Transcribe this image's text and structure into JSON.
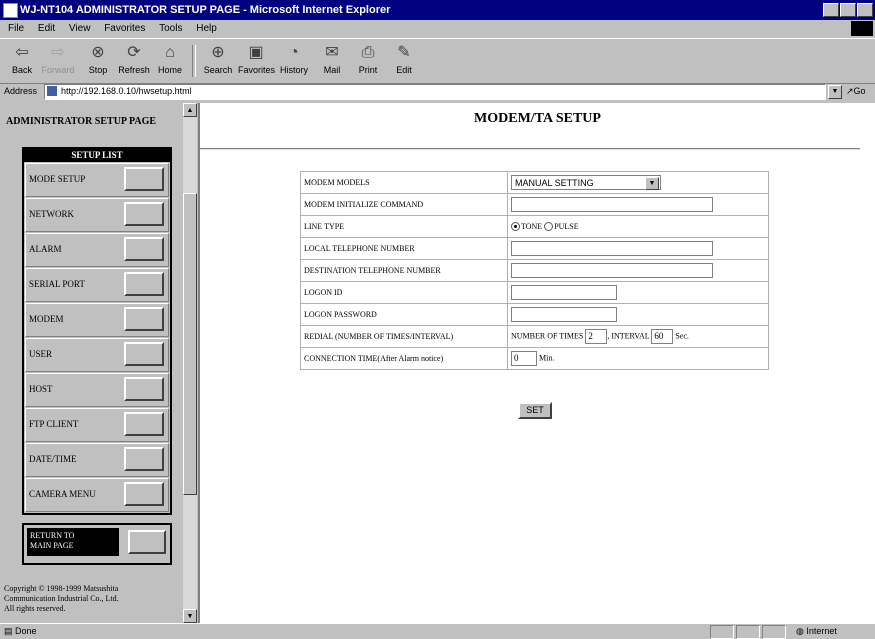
{
  "window": {
    "title": "WJ-NT104 ADMINISTRATOR SETUP PAGE - Microsoft Internet Explorer"
  },
  "menu": [
    "File",
    "Edit",
    "View",
    "Favorites",
    "Tools",
    "Help"
  ],
  "toolbar": [
    {
      "label": "Back",
      "icon": "back-arrow-icon"
    },
    {
      "label": "Forward",
      "icon": "forward-arrow-icon"
    },
    {
      "label": "Stop",
      "icon": "stop-icon"
    },
    {
      "label": "Refresh",
      "icon": "refresh-icon"
    },
    {
      "label": "Home",
      "icon": "home-icon"
    },
    {
      "label": "Search",
      "icon": "search-icon"
    },
    {
      "label": "Favorites",
      "icon": "favorites-icon"
    },
    {
      "label": "History",
      "icon": "history-icon"
    },
    {
      "label": "Mail",
      "icon": "mail-icon"
    },
    {
      "label": "Print",
      "icon": "print-icon"
    },
    {
      "label": "Edit",
      "icon": "edit-icon"
    }
  ],
  "address": {
    "label": "Address",
    "url": "http://192.168.0.10/hwsetup.html",
    "go": "Go"
  },
  "sidebar": {
    "title": "ADMINISTRATOR SETUP PAGE",
    "list_title": "SETUP LIST",
    "items": [
      "MODE SETUP",
      "NETWORK",
      "ALARM",
      "SERIAL PORT",
      "MODEM",
      "USER",
      "HOST",
      "FTP CLIENT",
      "DATE/TIME",
      "CAMERA MENU"
    ],
    "return_line1": "RETURN TO",
    "return_line2": "MAIN PAGE",
    "copyright1": "Copyright © 1998-1999 Matsushita",
    "copyright2": "Communication Industrial Co., Ltd.",
    "copyright3": "All rights reserved."
  },
  "main": {
    "title": "MODEM/TA SETUP",
    "rows": {
      "modem_models": {
        "label": "MODEM MODELS",
        "value": "MANUAL SETTING"
      },
      "init_command": {
        "label": "MODEM INITIALIZE COMMAND",
        "value": ""
      },
      "line_type": {
        "label": "LINE TYPE",
        "opt1": "TONE",
        "opt2": "PULSE",
        "selected": "TONE"
      },
      "local_tel": {
        "label": "LOCAL TELEPHONE NUMBER",
        "value": ""
      },
      "dest_tel": {
        "label": "DESTINATION TELEPHONE NUMBER",
        "value": ""
      },
      "logon_id": {
        "label": "LOGON ID",
        "value": ""
      },
      "logon_pw": {
        "label": "LOGON PASSWORD",
        "value": ""
      },
      "redial": {
        "label": "REDIAL (NUMBER OF TIMES/INTERVAL)",
        "times_label": "NUMBER OF TIMES",
        "times": "2",
        "sep": ",",
        "interval_label": "INTERVAL",
        "interval": "60",
        "unit": "Sec."
      },
      "connection": {
        "label": "CONNECTION TIME(After Alarm notice)",
        "value": "0",
        "unit": "Min."
      }
    },
    "set_label": "SET"
  },
  "status": {
    "text": "Done",
    "zone": "Internet"
  }
}
